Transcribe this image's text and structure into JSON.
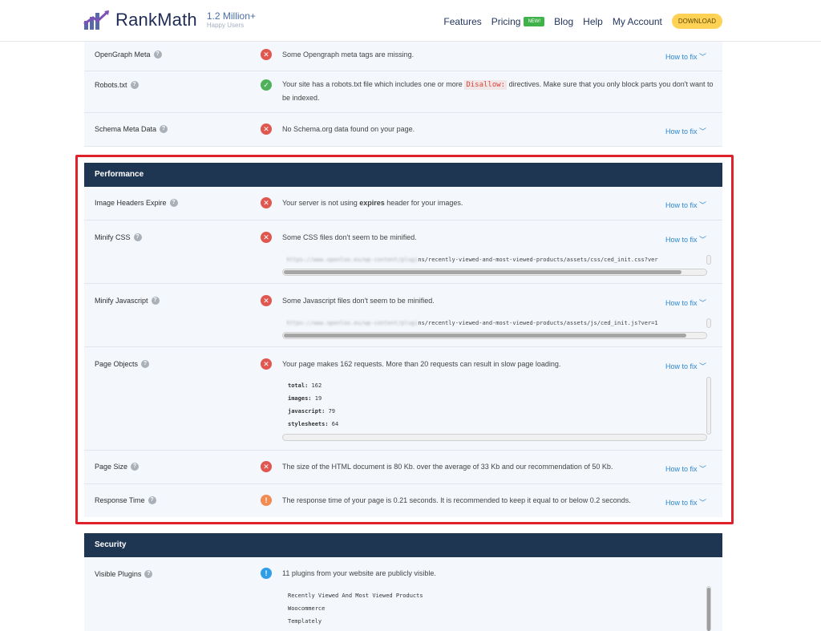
{
  "header": {
    "brand": "RankMath",
    "count_big": "1.2 Million+",
    "count_small": "Happy Users",
    "nav": {
      "features": "Features",
      "pricing": "Pricing",
      "new_badge": "NEW!",
      "blog": "Blog",
      "help": "Help",
      "account": "My Account",
      "download": "DOWNLOAD"
    }
  },
  "how_to_fix": "How to fix",
  "rows_top": [
    {
      "label": "OpenGraph Meta",
      "status": "fail",
      "message": "Some Opengraph meta tags are missing.",
      "fix": true
    },
    {
      "label": "Robots.txt",
      "status": "pass",
      "message_before": "Your site has a robots.txt file which includes one or more",
      "code": "Disallow:",
      "message_after": "directives. Make sure that you only block parts you don't want to be indexed.",
      "fix": false
    },
    {
      "label": "Schema Meta Data",
      "status": "fail",
      "message": "No Schema.org data found on your page.",
      "fix": true
    }
  ],
  "performance": {
    "title": "Performance",
    "image_headers": {
      "label": "Image Headers Expire",
      "msg_before": "Your server is not using",
      "msg_bold": "expires",
      "msg_after": "header for your images."
    },
    "minify_css": {
      "label": "Minify CSS",
      "message": "Some CSS files don't seem to be minified.",
      "url_blur": "https://www.openloo.eu/wp-content/plugi",
      "url": "ns/recently-viewed-and-most-viewed-products/assets/css/ced_init.css?ver",
      "scroll": 0.94
    },
    "minify_js": {
      "label": "Minify Javascript",
      "message": "Some Javascript files don't seem to be minified.",
      "url_blur": "https://www.openloo.eu/wp-content/plugi",
      "url": "ns/recently-viewed-and-most-viewed-products/assets/js/ced_init.js?ver=1",
      "scroll": 0.95
    },
    "page_objects": {
      "label": "Page Objects",
      "message": "Your page makes 162 requests. More than 20 requests can result in slow page loading.",
      "stats": [
        {
          "key": "total:",
          "value": "162"
        },
        {
          "key": "images:",
          "value": "19"
        },
        {
          "key": "javascript:",
          "value": "79"
        },
        {
          "key": "stylesheets:",
          "value": "64"
        }
      ]
    },
    "page_size": {
      "label": "Page Size",
      "message": "The size of the HTML document is 80 Kb. over the average of 33 Kb and our recommendation of 50 Kb."
    },
    "response_time": {
      "label": "Response Time",
      "message": "The response time of your page is 0.21 seconds. It is recommended to keep it equal to or below 0.2 seconds."
    }
  },
  "security": {
    "title": "Security",
    "visible_plugins": {
      "label": "Visible Plugins",
      "message": "11 plugins from your website are publicly visible.",
      "plugins": [
        "Recently Viewed And Most Viewed Products",
        "Woocommerce",
        "Templately"
      ]
    }
  }
}
